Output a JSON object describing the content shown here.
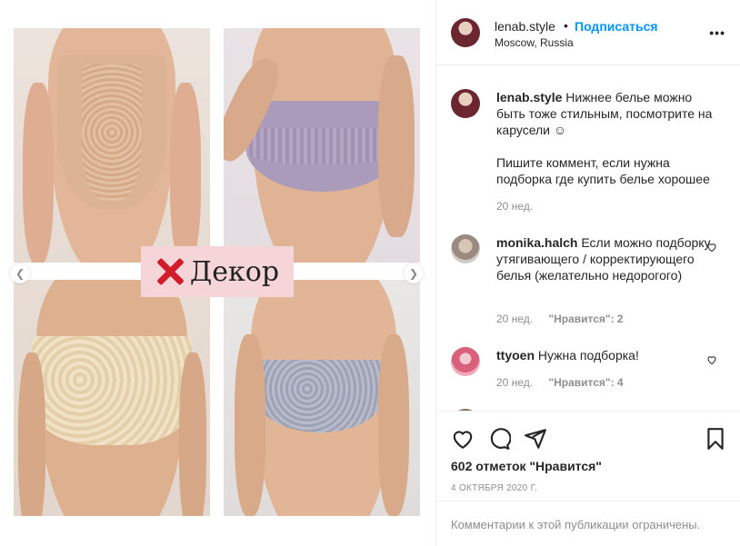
{
  "post": {
    "image_label": "Декор",
    "author": "lenab.style",
    "follow_label": "Подписаться",
    "location": "Moscow, Russia",
    "caption_line1": "Нижнее белье можно быть тоже стильным, посмотрите на карусели ☺",
    "caption_line2": "Пишите коммент, если нужна подборка где купить белье хорошее",
    "caption_time": "20 нед."
  },
  "comments": [
    {
      "user": "monika.halch",
      "text": "Если можно подборку утягивающего / корректирующего белья (желательно недорогого)",
      "time": "20 нед.",
      "likes": "\"Нравится\": 2"
    },
    {
      "user": "ttyoen",
      "text": "Нужна подборка!",
      "time": "20 нед.",
      "likes": "\"Нравится\": 4"
    }
  ],
  "engagement": {
    "likes_text": "602 отметок \"Нравится\"",
    "date": "4 ОКТЯБРЯ 2020 Г."
  },
  "footer": {
    "comments_limited": "Комментарии к этой публикации ограничены."
  },
  "icons": {
    "more": "more-options-icon",
    "like": "heart-icon",
    "comment": "comment-icon",
    "share": "share-icon",
    "save": "bookmark-icon",
    "prev": "chevron-left-icon",
    "next": "chevron-right-icon"
  },
  "colors": {
    "accent": "#0095f6",
    "muted": "#8e8e8e",
    "label_bg": "#f6d5d9",
    "x_red": "#d31c2a"
  }
}
